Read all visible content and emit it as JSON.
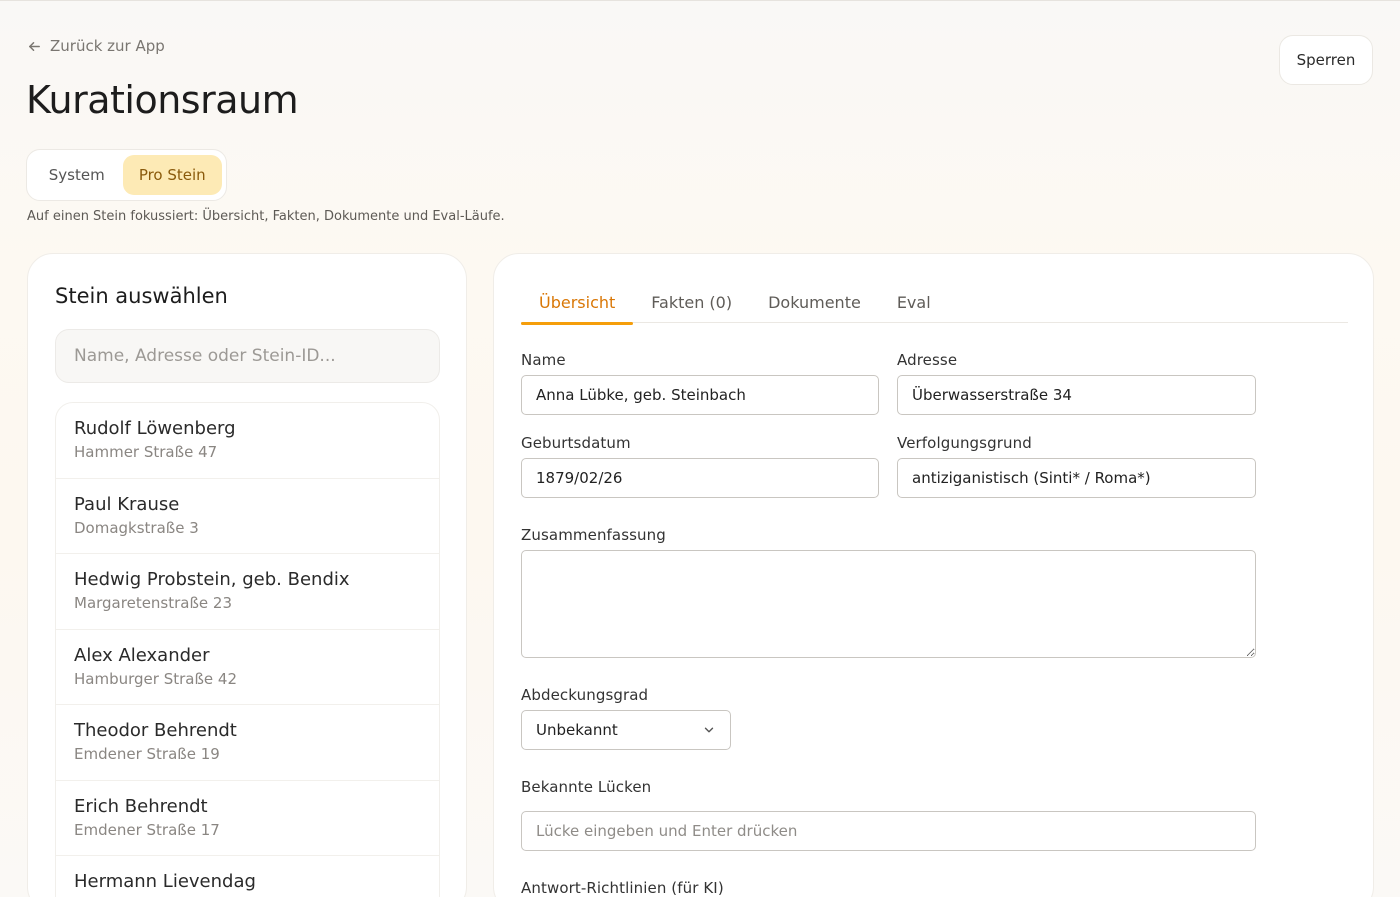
{
  "header": {
    "back_label": "Zurück zur App",
    "title": "Kurationsraum",
    "lock_label": "Sperren"
  },
  "mode_switch": {
    "options": [
      "System",
      "Pro Stein"
    ],
    "selected": "Pro Stein",
    "description": "Auf einen Stein fokussiert: Übersicht, Fakten, Dokumente und Eval-Läufe."
  },
  "stone_picker": {
    "title": "Stein auswählen",
    "search_placeholder": "Name, Adresse oder Stein-ID...",
    "items": [
      {
        "name": "Rudolf Löwenberg",
        "address": "Hammer Straße 47"
      },
      {
        "name": "Paul Krause",
        "address": "Domagkstraße 3"
      },
      {
        "name": "Hedwig Probstein, geb. Bendix",
        "address": "Margaretenstraße 23"
      },
      {
        "name": "Alex Alexander",
        "address": "Hamburger Straße 42"
      },
      {
        "name": "Theodor Behrendt",
        "address": "Emdener Straße 19"
      },
      {
        "name": "Erich Behrendt",
        "address": "Emdener Straße 17"
      },
      {
        "name": "Hermann Lievendag",
        "address": ""
      }
    ]
  },
  "detail": {
    "tabs": [
      "Übersicht",
      "Fakten (0)",
      "Dokumente",
      "Eval"
    ],
    "active_tab": "Übersicht",
    "fields": {
      "name_label": "Name",
      "name_value": "Anna Lübke, geb. Steinbach",
      "address_label": "Adresse",
      "address_value": "Überwasserstraße 34",
      "birthdate_label": "Geburtsdatum",
      "birthdate_value": "1879/02/26",
      "persecution_label": "Verfolgungsgrund",
      "persecution_value": "antiziganistisch (Sinti* / Roma*)",
      "summary_label": "Zusammenfassung",
      "summary_value": "",
      "coverage_label": "Abdeckungsgrad",
      "coverage_value": "Unbekannt",
      "gaps_label": "Bekannte Lücken",
      "gaps_placeholder": "Lücke eingeben und Enter drücken",
      "guidelines_label": "Antwort-Richtlinien (für KI)"
    }
  },
  "colors": {
    "accent": "#d97706",
    "accent_bg": "#fdeab5"
  },
  "icons": {
    "back": "arrow-left-icon",
    "select": "chevron-down-icon"
  }
}
